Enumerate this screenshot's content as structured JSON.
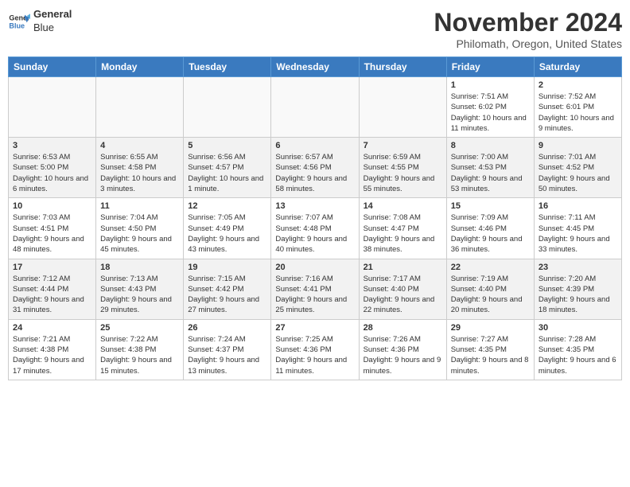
{
  "logo": {
    "line1": "General",
    "line2": "Blue"
  },
  "title": "November 2024",
  "subtitle": "Philomath, Oregon, United States",
  "headers": [
    "Sunday",
    "Monday",
    "Tuesday",
    "Wednesday",
    "Thursday",
    "Friday",
    "Saturday"
  ],
  "weeks": [
    [
      {
        "day": "",
        "info": ""
      },
      {
        "day": "",
        "info": ""
      },
      {
        "day": "",
        "info": ""
      },
      {
        "day": "",
        "info": ""
      },
      {
        "day": "",
        "info": ""
      },
      {
        "day": "1",
        "info": "Sunrise: 7:51 AM\nSunset: 6:02 PM\nDaylight: 10 hours and 11 minutes."
      },
      {
        "day": "2",
        "info": "Sunrise: 7:52 AM\nSunset: 6:01 PM\nDaylight: 10 hours and 9 minutes."
      }
    ],
    [
      {
        "day": "3",
        "info": "Sunrise: 6:53 AM\nSunset: 5:00 PM\nDaylight: 10 hours and 6 minutes."
      },
      {
        "day": "4",
        "info": "Sunrise: 6:55 AM\nSunset: 4:58 PM\nDaylight: 10 hours and 3 minutes."
      },
      {
        "day": "5",
        "info": "Sunrise: 6:56 AM\nSunset: 4:57 PM\nDaylight: 10 hours and 1 minute."
      },
      {
        "day": "6",
        "info": "Sunrise: 6:57 AM\nSunset: 4:56 PM\nDaylight: 9 hours and 58 minutes."
      },
      {
        "day": "7",
        "info": "Sunrise: 6:59 AM\nSunset: 4:55 PM\nDaylight: 9 hours and 55 minutes."
      },
      {
        "day": "8",
        "info": "Sunrise: 7:00 AM\nSunset: 4:53 PM\nDaylight: 9 hours and 53 minutes."
      },
      {
        "day": "9",
        "info": "Sunrise: 7:01 AM\nSunset: 4:52 PM\nDaylight: 9 hours and 50 minutes."
      }
    ],
    [
      {
        "day": "10",
        "info": "Sunrise: 7:03 AM\nSunset: 4:51 PM\nDaylight: 9 hours and 48 minutes."
      },
      {
        "day": "11",
        "info": "Sunrise: 7:04 AM\nSunset: 4:50 PM\nDaylight: 9 hours and 45 minutes."
      },
      {
        "day": "12",
        "info": "Sunrise: 7:05 AM\nSunset: 4:49 PM\nDaylight: 9 hours and 43 minutes."
      },
      {
        "day": "13",
        "info": "Sunrise: 7:07 AM\nSunset: 4:48 PM\nDaylight: 9 hours and 40 minutes."
      },
      {
        "day": "14",
        "info": "Sunrise: 7:08 AM\nSunset: 4:47 PM\nDaylight: 9 hours and 38 minutes."
      },
      {
        "day": "15",
        "info": "Sunrise: 7:09 AM\nSunset: 4:46 PM\nDaylight: 9 hours and 36 minutes."
      },
      {
        "day": "16",
        "info": "Sunrise: 7:11 AM\nSunset: 4:45 PM\nDaylight: 9 hours and 33 minutes."
      }
    ],
    [
      {
        "day": "17",
        "info": "Sunrise: 7:12 AM\nSunset: 4:44 PM\nDaylight: 9 hours and 31 minutes."
      },
      {
        "day": "18",
        "info": "Sunrise: 7:13 AM\nSunset: 4:43 PM\nDaylight: 9 hours and 29 minutes."
      },
      {
        "day": "19",
        "info": "Sunrise: 7:15 AM\nSunset: 4:42 PM\nDaylight: 9 hours and 27 minutes."
      },
      {
        "day": "20",
        "info": "Sunrise: 7:16 AM\nSunset: 4:41 PM\nDaylight: 9 hours and 25 minutes."
      },
      {
        "day": "21",
        "info": "Sunrise: 7:17 AM\nSunset: 4:40 PM\nDaylight: 9 hours and 22 minutes."
      },
      {
        "day": "22",
        "info": "Sunrise: 7:19 AM\nSunset: 4:40 PM\nDaylight: 9 hours and 20 minutes."
      },
      {
        "day": "23",
        "info": "Sunrise: 7:20 AM\nSunset: 4:39 PM\nDaylight: 9 hours and 18 minutes."
      }
    ],
    [
      {
        "day": "24",
        "info": "Sunrise: 7:21 AM\nSunset: 4:38 PM\nDaylight: 9 hours and 17 minutes."
      },
      {
        "day": "25",
        "info": "Sunrise: 7:22 AM\nSunset: 4:38 PM\nDaylight: 9 hours and 15 minutes."
      },
      {
        "day": "26",
        "info": "Sunrise: 7:24 AM\nSunset: 4:37 PM\nDaylight: 9 hours and 13 minutes."
      },
      {
        "day": "27",
        "info": "Sunrise: 7:25 AM\nSunset: 4:36 PM\nDaylight: 9 hours and 11 minutes."
      },
      {
        "day": "28",
        "info": "Sunrise: 7:26 AM\nSunset: 4:36 PM\nDaylight: 9 hours and 9 minutes."
      },
      {
        "day": "29",
        "info": "Sunrise: 7:27 AM\nSunset: 4:35 PM\nDaylight: 9 hours and 8 minutes."
      },
      {
        "day": "30",
        "info": "Sunrise: 7:28 AM\nSunset: 4:35 PM\nDaylight: 9 hours and 6 minutes."
      }
    ]
  ]
}
